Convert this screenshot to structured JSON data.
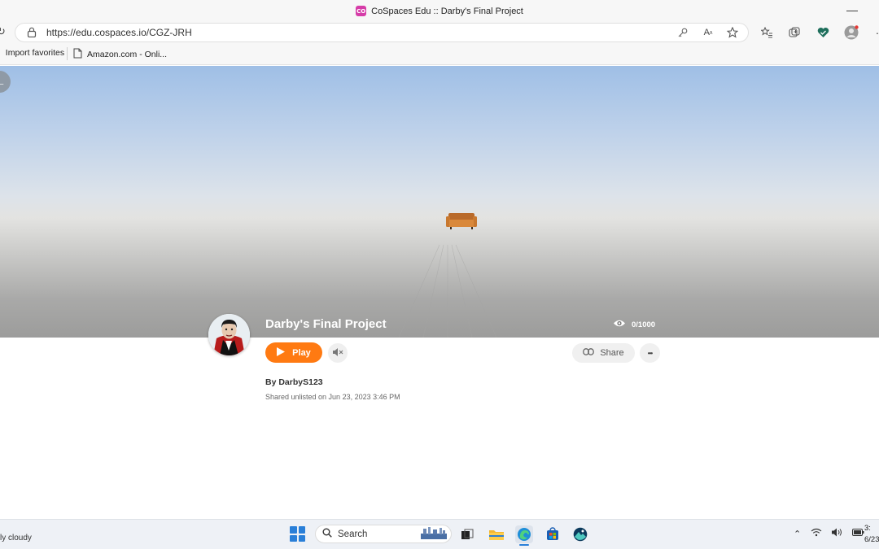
{
  "browser": {
    "tab_title": "CoSpaces Edu :: Darby's Final Project",
    "tab_icon": "cospaces-logo-icon",
    "url": "https://edu.cospaces.io/CGZ-JRH",
    "favorites": [
      {
        "label": "Import favorites",
        "icon": "import-icon"
      },
      {
        "label": "Amazon.com - Onli...",
        "icon": "page-icon"
      }
    ]
  },
  "project": {
    "title": "Darby's Final Project",
    "views": "0/1000",
    "play_label": "Play",
    "share_label": "Share",
    "more_label": "•••",
    "author": "By DarbyS123",
    "shared": "Shared unlisted on Jun 23, 2023 3:46 PM"
  },
  "taskbar": {
    "weather": "ly cloudy",
    "search_label": "Search",
    "clock_time": "3:",
    "clock_date": "6/23"
  },
  "colors": {
    "play_button": "#ff7a12",
    "sky_top": "#9fbfe6",
    "floor": "#9c9c9b"
  }
}
